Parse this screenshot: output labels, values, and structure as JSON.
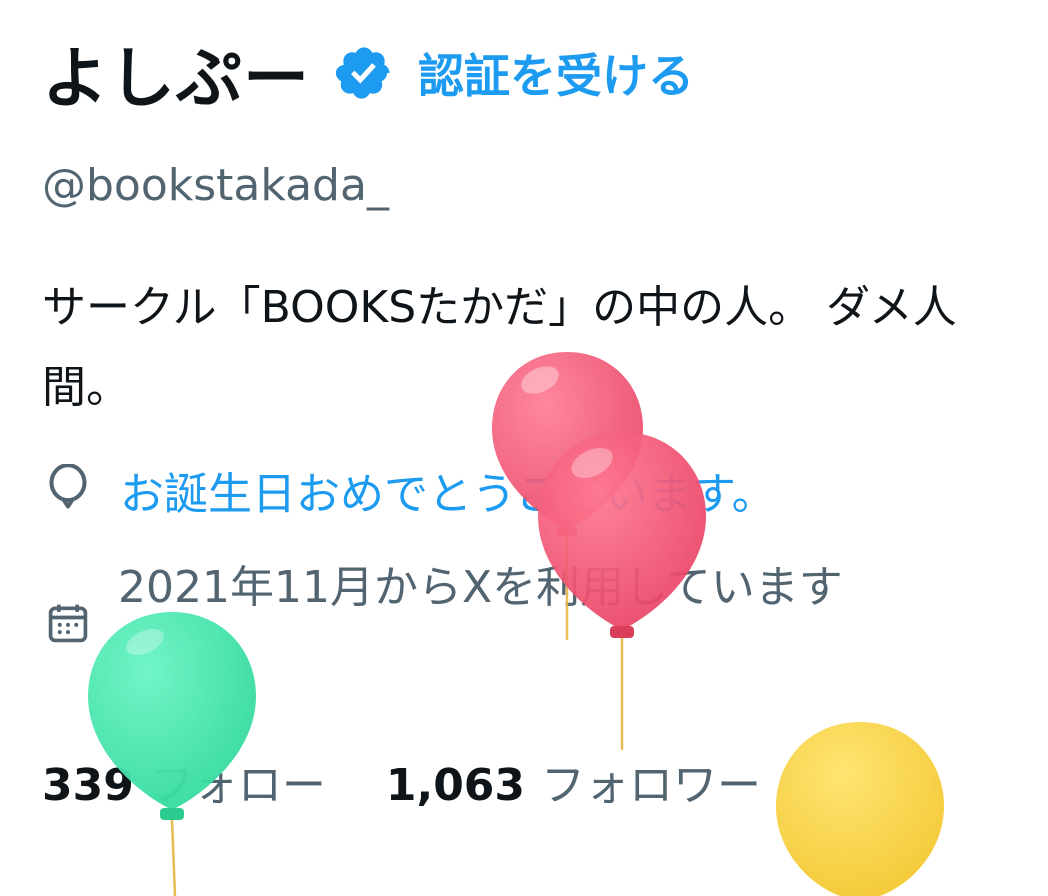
{
  "profile": {
    "display_name": "よしぷー",
    "verified_badge_icon": "verified-check-icon",
    "get_verified_label": "認証を受ける",
    "handle": "@bookstakada_",
    "bio": "サークル「BOOKSたかだ」の中の人。 ダメ人間。",
    "birthday_icon": "balloon-icon",
    "birthday_text": "お誕生日おめでとうございます。",
    "joined_icon": "calendar-icon",
    "joined_text": "2021年11月からXを利用しています",
    "following_count": "339",
    "following_label": "フォロー",
    "followers_count": "1,063",
    "followers_label": "フォロワー"
  },
  "colors": {
    "accent": "#1d9bf0",
    "text_primary": "#0f1419",
    "text_secondary": "#536471",
    "balloon_red": "#f0506e",
    "balloon_green": "#3ee0a6",
    "balloon_yellow": "#f7d038"
  }
}
